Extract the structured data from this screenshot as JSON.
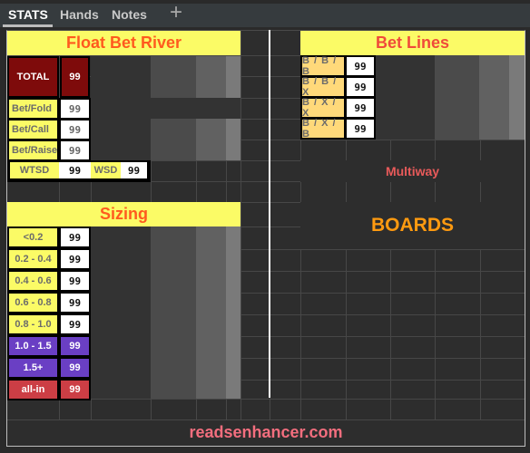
{
  "tabs": [
    {
      "label": "STATS",
      "active": true
    },
    {
      "label": "Hands",
      "active": false
    },
    {
      "label": "Notes",
      "active": false
    }
  ],
  "add_tab_icon": "plus-icon",
  "float_bet_river": {
    "title": "Float Bet River",
    "total": {
      "label": "TOTAL",
      "value": "99"
    },
    "rows": [
      {
        "label": "Bet/Fold",
        "value": "99"
      },
      {
        "label": "Bet/Call",
        "value": "99"
      },
      {
        "label": "Bet/Raise",
        "value": "99"
      }
    ],
    "wtsd": {
      "label": "WTSD",
      "value": "99"
    },
    "wsd": {
      "label": "WSD",
      "value": "99"
    }
  },
  "sizing": {
    "title": "Sizing",
    "rows": [
      {
        "label": "<0.2",
        "value": "99"
      },
      {
        "label": "0.2 - 0.4",
        "value": "99"
      },
      {
        "label": "0.4 - 0.6",
        "value": "99"
      },
      {
        "label": "0.6 - 0.8",
        "value": "99"
      },
      {
        "label": "0.8 - 1.0",
        "value": "99"
      },
      {
        "label": "1.0 - 1.5",
        "value": "99"
      },
      {
        "label": "1.5+",
        "value": "99"
      },
      {
        "label": "all-in",
        "value": "99"
      }
    ]
  },
  "bet_lines": {
    "title": "Bet Lines",
    "rows": [
      {
        "label": "B / B / B",
        "value": "99"
      },
      {
        "label": "B / B / X",
        "value": "99"
      },
      {
        "label": "B / X / X",
        "value": "99"
      },
      {
        "label": "B / X / B",
        "value": "99"
      }
    ]
  },
  "multiway_label": "Multiway",
  "boards_label": "BOARDS",
  "footer_link": "readsenhancer.com",
  "colors": {
    "header_yellow": "#fbfb66",
    "title_orange": "#ff5a1e",
    "bet_lines_red": "#f04a3a",
    "total_dark_red": "#7e0b0b",
    "purple": "#6a3fc4",
    "allin_red": "#cc3e45",
    "boards_orange": "#ff9a10",
    "multiway_red": "#e85a5a",
    "footer_pink": "#f36e7e"
  }
}
